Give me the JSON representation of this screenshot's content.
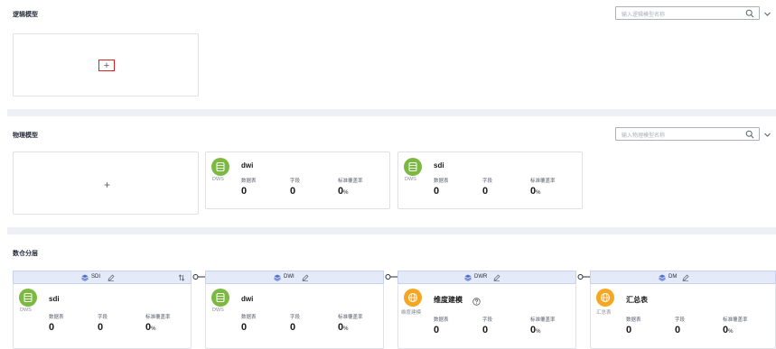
{
  "logical": {
    "title": "逻辑模型",
    "search_placeholder": "输入逻辑模型名称",
    "add_label": "+"
  },
  "physical": {
    "title": "物理模型",
    "search_placeholder": "输入物理模型名称",
    "add_label": "+",
    "cards": [
      {
        "badge": "DWS",
        "name": "dwi",
        "labels": [
          "数据表",
          "字段",
          "标准覆盖率"
        ],
        "values": [
          "0",
          "0",
          "0"
        ],
        "unit": "%"
      },
      {
        "badge": "DWS",
        "name": "sdi",
        "labels": [
          "数据表",
          "字段",
          "标准覆盖率"
        ],
        "values": [
          "0",
          "0",
          "0"
        ],
        "unit": "%"
      }
    ]
  },
  "warehouse": {
    "title": "数仓分层",
    "layers": [
      {
        "head": "SDI",
        "badge": "DWS",
        "name": "sdi",
        "labels": [
          "数据表",
          "字段",
          "标准覆盖率"
        ],
        "values": [
          "0",
          "0",
          "0"
        ],
        "unit": "%"
      },
      {
        "head": "DWI",
        "badge": "DWS",
        "name": "dwi",
        "labels": [
          "数据表",
          "字段",
          "标准覆盖率"
        ],
        "values": [
          "0",
          "0",
          "0"
        ],
        "unit": "%"
      },
      {
        "head": "DWR",
        "badge": "维度建模",
        "name": "维度建模",
        "labels": [
          "数据表",
          "字段",
          "标准覆盖率"
        ],
        "values": [
          "0",
          "0",
          "0"
        ],
        "unit": "%"
      },
      {
        "head": "DM",
        "badge": "汇总表",
        "name": "汇总表",
        "labels": [
          "数据表",
          "字段",
          "标准覆盖率"
        ],
        "values": [
          "0",
          "0",
          "0"
        ],
        "unit": "%"
      }
    ]
  },
  "colors": {
    "dws_badge": "#7cb943",
    "model_badge": "#f5a623",
    "layer_header": "#e4eaf7",
    "accent": "#526ecc"
  },
  "icons": [
    "search-icon",
    "chevron-down-icon",
    "database-icon",
    "globe-icon",
    "edit-icon",
    "layers-icon",
    "sort-icon",
    "help-icon",
    "arrow-connector-icon"
  ]
}
